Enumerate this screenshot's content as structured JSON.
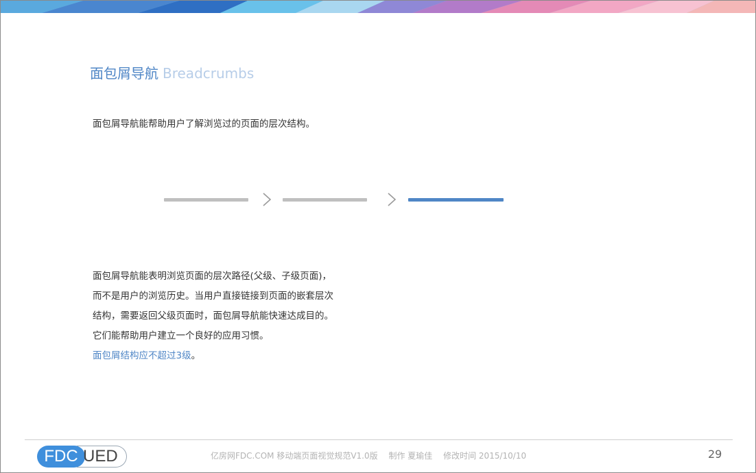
{
  "title": {
    "cn": "面包屑导航",
    "en": "Breadcrumbs"
  },
  "intro": "面包屑导航能帮助用户了解浏览过的页面的层次结构。",
  "body_lines": [
    "面包屑导航能表明浏览页面的层次路径(父级、子级页面)，",
    "而不是用户的浏览历史。当用户直接链接到页面的嵌套层次",
    "结构，需要返回父级页面时，面包屑导航能快速达成目的。",
    "它们能帮助用户建立一个良好的应用习惯。"
  ],
  "note": {
    "text": "面包屑结构应不超过3级",
    "tail": "。"
  },
  "footer": {
    "logo_left": "FDC",
    "logo_right": "UED",
    "site": "亿房网FDC.COM 移动端页面视觉规范V1.0版",
    "author": "制作 夏瑜佳",
    "modified": "修改时间  2015/10/10",
    "page_number": "29"
  },
  "colors": {
    "accent": "#4f86c6",
    "inactive": "#bfbfbf"
  }
}
